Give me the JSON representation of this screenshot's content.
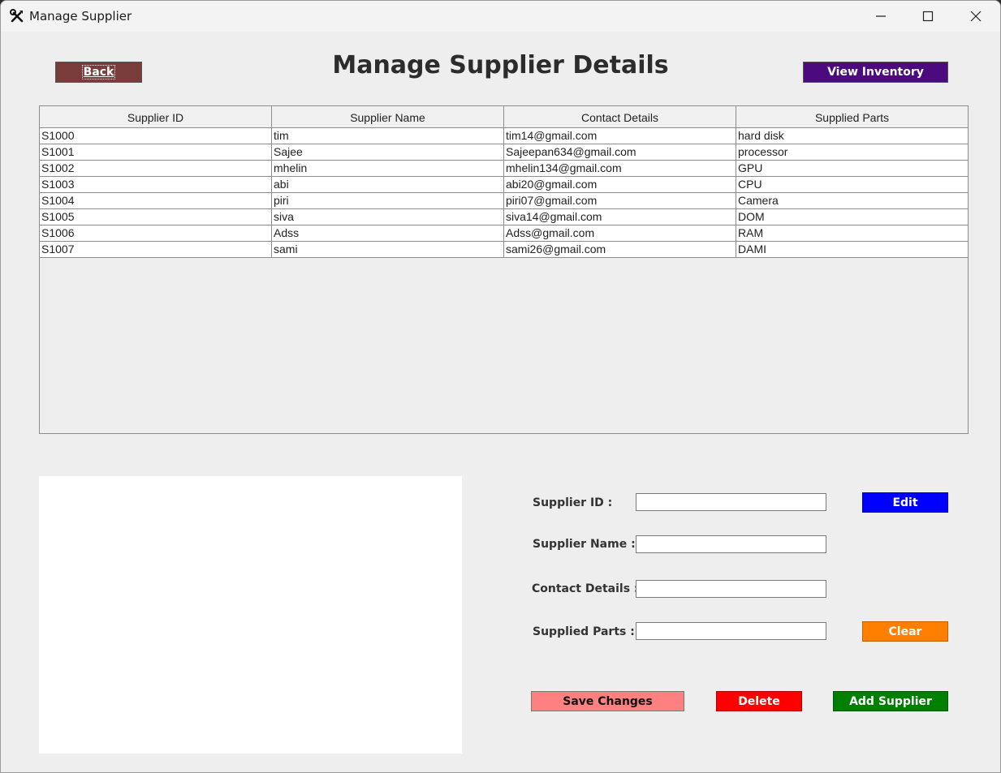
{
  "window": {
    "title": "Manage Supplier",
    "icon": "tools-icon"
  },
  "header": {
    "back_label": "Back",
    "title": "Manage Supplier Details",
    "view_inventory_label": "View Inventory"
  },
  "table": {
    "columns": [
      "Supplier ID",
      "Supplier Name",
      "Contact Details",
      "Supplied Parts"
    ],
    "rows": [
      [
        "S1000",
        "tim",
        "tim14@gmail.com",
        "hard disk"
      ],
      [
        "S1001",
        "Sajee",
        "Sajeepan634@gmail.com",
        "processor"
      ],
      [
        "S1002",
        "mhelin",
        "mhelin134@gmail.com",
        "GPU"
      ],
      [
        "S1003",
        "abi",
        "abi20@gmail.com",
        "CPU"
      ],
      [
        "S1004",
        "piri",
        "piri07@gmail.com",
        "Camera"
      ],
      [
        "S1005",
        "siva",
        "siva14@gmail.com",
        "DOM"
      ],
      [
        "S1006",
        "Adss",
        "Adss@gmail.com",
        "RAM"
      ],
      [
        "S1007",
        "sami",
        "sami26@gmail.com",
        "DAMI"
      ]
    ]
  },
  "form": {
    "supplier_id_label": "Supplier ID :",
    "supplier_id_value": "",
    "supplier_name_label": "Supplier Name :",
    "supplier_name_value": "",
    "contact_label": "Contact Details :",
    "contact_value": "",
    "parts_label": "Supplied Parts :",
    "parts_value": ""
  },
  "buttons": {
    "edit": "Edit",
    "clear": "Clear",
    "save": "Save Changes",
    "delete": "Delete",
    "add": "Add Supplier"
  },
  "colors": {
    "back_bg": "#7a3b3b",
    "view_inventory_bg": "#4b0a7e",
    "edit_bg": "#0000ff",
    "clear_bg": "#ff8000",
    "save_bg": "#ff8080",
    "delete_bg": "#ff0000",
    "add_bg": "#008000"
  }
}
